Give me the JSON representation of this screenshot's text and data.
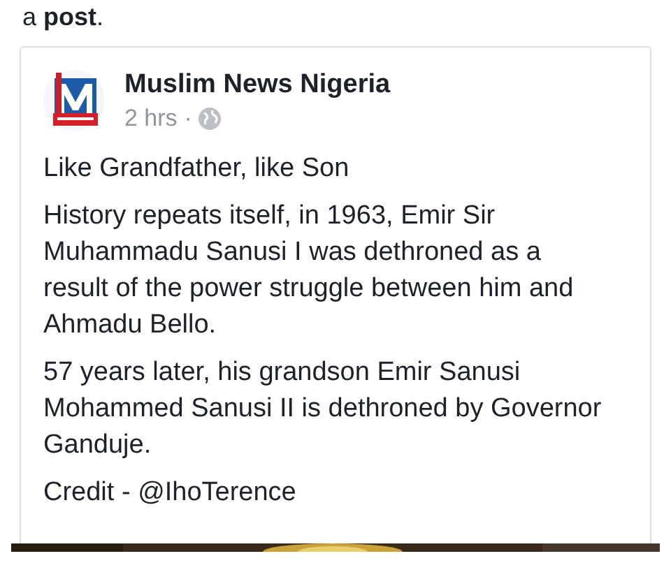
{
  "intro": "a **post**.",
  "post": {
    "author": "Muslim News Nigeria",
    "time": "2 hrs",
    "separator": "·",
    "paragraphs": [
      "Like Grandfather, like Son",
      "History repeats itself, in 1963, Emir Sir Muhammadu Sanusi I was dethroned as a result of the power struggle between him and Ahmadu Bello.",
      "57 years later, his grandson Emir Sanusi Mohammed Sanusi II is dethroned by Governor Ganduje.",
      "Credit - @IhoTerence"
    ]
  }
}
